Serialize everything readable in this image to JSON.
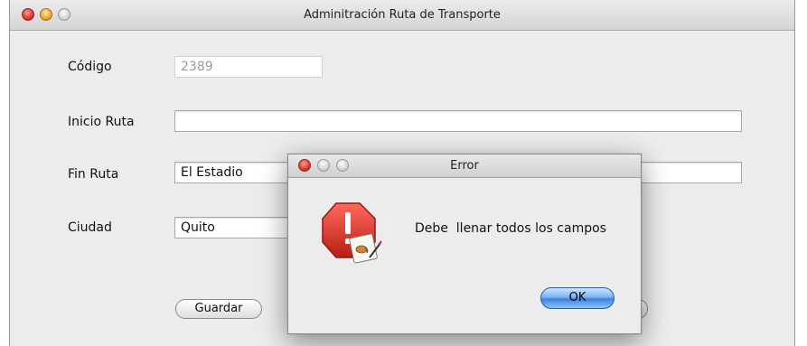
{
  "window": {
    "title": "Adminitración Ruta de Transporte"
  },
  "form": {
    "codigo": {
      "label": "Código",
      "value": "2389"
    },
    "inicio_ruta": {
      "label": "Inicio Ruta",
      "value": ""
    },
    "fin_ruta": {
      "label": "Fin Ruta",
      "value": "El Estadio"
    },
    "ciudad": {
      "label": "Ciudad",
      "value": "Quito"
    },
    "save_label": "Guardar"
  },
  "dialog": {
    "title": "Error",
    "message": "Debe  llenar todos los campos",
    "ok_label": "OK",
    "icon": "error-stop-icon"
  },
  "colors": {
    "error_icon": "#d8392b",
    "ok_button": "#5a9be8"
  }
}
